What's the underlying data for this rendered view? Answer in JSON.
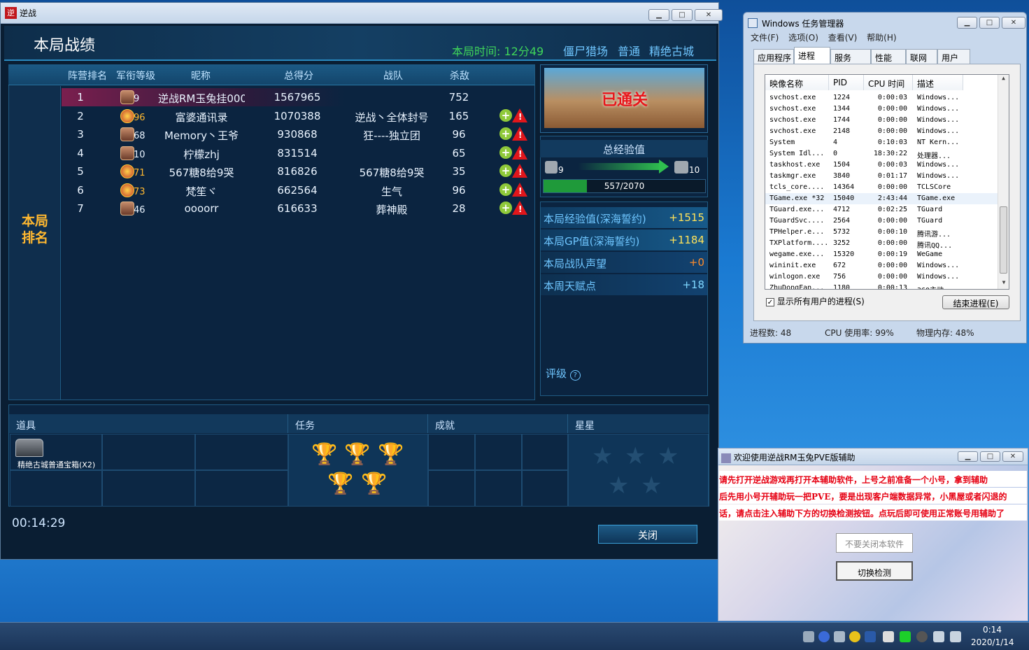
{
  "game": {
    "title": "逆战",
    "heading": "本局战绩",
    "time_label": "本局时间: 12分49",
    "mode": "僵尸猎场",
    "difficulty": "普通",
    "map": "精绝古城",
    "left_label": "本局\n排名",
    "columns": [
      "阵营排名",
      "军衔等级",
      "昵称",
      "总得分",
      "战队",
      "杀敌"
    ],
    "players": [
      {
        "rank": "1",
        "level": "9",
        "badge": "bronze",
        "name": "逆战RM玉兔挂000",
        "score": "1567965",
        "team": "",
        "kills": "752",
        "me": true
      },
      {
        "rank": "2",
        "level": "96",
        "badge": "gold",
        "name": "富婆通讯录",
        "score": "1070388",
        "team": "逆战丶全体封号",
        "kills": "165",
        "me": false
      },
      {
        "rank": "3",
        "level": "68",
        "badge": "silver",
        "name": "Memory丶王爷",
        "score": "930868",
        "team": "狂----独立团",
        "kills": "96",
        "me": false
      },
      {
        "rank": "4",
        "level": "10",
        "badge": "bronze",
        "name": "柠檬zhj",
        "score": "831514",
        "team": "",
        "kills": "65",
        "me": false
      },
      {
        "rank": "5",
        "level": "71",
        "badge": "gold",
        "name": "567糖8给9哭",
        "score": "816826",
        "team": "567糖8给9哭",
        "kills": "35",
        "me": false
      },
      {
        "rank": "6",
        "level": "73",
        "badge": "gold",
        "name": "梵笙ヾ",
        "score": "662564",
        "team": "生气",
        "kills": "96",
        "me": false
      },
      {
        "rank": "7",
        "level": "46",
        "badge": "silver",
        "name": "oooorr",
        "score": "616633",
        "team": "葬神殿",
        "kills": "28",
        "me": false
      }
    ],
    "cleared": "已通关",
    "exp_title": "总经验值",
    "exp_from": "9",
    "exp_to": "10",
    "exp_text": "557/2070",
    "exp_progress": 0.27,
    "rewards": [
      {
        "label": "本局经验值(深海誓约)",
        "value": "+1515",
        "color": "#ffe25a"
      },
      {
        "label": "本局GP值(深海誓约)",
        "value": "+1184",
        "color": "#ffe25a"
      },
      {
        "label": "本局战队声望",
        "value": "+0",
        "color": "#ff8c2a"
      },
      {
        "label": "本周天赋点",
        "value": "+18",
        "color": "#7fd7ff"
      }
    ],
    "rating": "评级",
    "bottom_tabs": [
      "道具",
      "任务",
      "成就",
      "星星"
    ],
    "item_name": "精绝古城普通宝箱(X2)",
    "elapsed": "00:14:29",
    "close": "关闭"
  },
  "taskmgr": {
    "title": "Windows 任务管理器",
    "menu": [
      "文件(F)",
      "选项(O)",
      "查看(V)",
      "帮助(H)"
    ],
    "tabs": [
      "应用程序",
      "进程",
      "服务",
      "性能",
      "联网",
      "用户"
    ],
    "active_tab": "进程",
    "headers": [
      "映像名称",
      "PID",
      "CPU 时间",
      "描述"
    ],
    "rows": [
      [
        "svchost.exe",
        "1224",
        "0:00:03",
        "Windows..."
      ],
      [
        "svchost.exe",
        "1344",
        "0:00:00",
        "Windows..."
      ],
      [
        "svchost.exe",
        "1744",
        "0:00:00",
        "Windows..."
      ],
      [
        "svchost.exe",
        "2148",
        "0:00:00",
        "Windows..."
      ],
      [
        "System",
        "4",
        "0:10:03",
        "NT Kern..."
      ],
      [
        "System Idl...",
        "0",
        "18:30:22",
        "处理器..."
      ],
      [
        "taskhost.exe",
        "1504",
        "0:00:03",
        "Windows..."
      ],
      [
        "taskmgr.exe",
        "3840",
        "0:01:17",
        "Windows..."
      ],
      [
        "tcls_core....",
        "14364",
        "0:00:00",
        "TCLSCore"
      ],
      [
        "TGame.exe *32",
        "15040",
        "2:43:44",
        "TGame.exe"
      ],
      [
        "TGuard.exe...",
        "4712",
        "0:02:25",
        "TGuard"
      ],
      [
        "TGuardSvc....",
        "2564",
        "0:00:00",
        "TGuard"
      ],
      [
        "TPHelper.e...",
        "5732",
        "0:00:10",
        "腾讯游..."
      ],
      [
        "TXPlatform....",
        "3252",
        "0:00:00",
        "腾讯QQ..."
      ],
      [
        "wegame.exe...",
        "15320",
        "0:00:19",
        "WeGame"
      ],
      [
        "wininit.exe",
        "672",
        "0:00:00",
        "Windows..."
      ],
      [
        "winlogon.exe",
        "756",
        "0:00:00",
        "Windows..."
      ],
      [
        "ZhuDongFan...",
        "1180",
        "0:00:13",
        "360主动..."
      ]
    ],
    "selected_row": 9,
    "show_all": "显示所有用户的进程(S)",
    "end_process": "结束进程(E)",
    "process_count": "进程数: 48",
    "cpu": "CPU 使用率: 99%",
    "memory": "物理内存: 48%"
  },
  "assist": {
    "title": "欢迎使用逆战RM玉兔PVE版辅助",
    "lines": [
      "请先打开逆战游戏再打开本辅助软件，上号之前准备一个小号，拿到辅助",
      "后先用小号开辅助玩一把PVE，要是出现客户端数据异常，小黑屋或者闪退的",
      "话，请点击注入辅助下方的切换检测按钮。点玩后即可使用正常账号用辅助了"
    ],
    "input_placeholder": "不要关闭本软件",
    "switch_button": "切换检测"
  },
  "taskbar": {
    "time": "0:14",
    "date": "2020/1/14"
  }
}
